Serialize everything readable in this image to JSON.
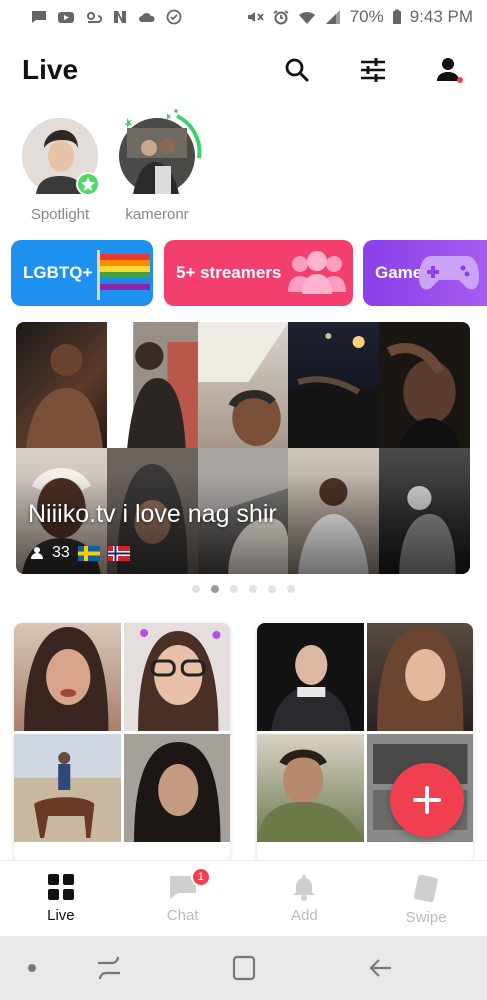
{
  "statusbar": {
    "battery": "70%",
    "time": "9:43 PM",
    "icons": [
      "message-icon",
      "youtube-icon",
      "weather-icon",
      "n-icon",
      "cloud-icon",
      "check-circle-icon",
      "mute-icon",
      "alarm-icon",
      "wifi-icon",
      "signal-icon",
      "battery-icon"
    ]
  },
  "header": {
    "title": "Live",
    "actions": [
      "search-icon",
      "filter-icon",
      "profile-icon"
    ],
    "profile_dot_color": "#f0404f"
  },
  "stories": [
    {
      "label": "Spotlight",
      "badge": "star-badge-icon"
    },
    {
      "label": "kameronr",
      "ring_color": "#3dd16b"
    }
  ],
  "categories": [
    {
      "label": "LGBTQ+",
      "color": "#1e90f0",
      "icon": "rainbow-flag-icon"
    },
    {
      "label": "5+ streamers",
      "color": "#f23f6d",
      "icon": "group-icon"
    },
    {
      "label": "Game",
      "color": "#8a3fe8",
      "icon": "gamepad-icon"
    }
  ],
  "featured": {
    "title": "Niiiko.tv i love nag shir",
    "viewers": "33",
    "flags": [
      "sweden-flag-icon",
      "norway-flag-icon"
    ],
    "page_count": 6,
    "active_page": 2
  },
  "cards": [
    {
      "name": "stream-card-1"
    },
    {
      "name": "stream-card-2"
    }
  ],
  "tabs": [
    {
      "label": "Live",
      "icon": "grid-icon",
      "active": true
    },
    {
      "label": "Chat",
      "icon": "chat-icon",
      "badge": "1"
    },
    {
      "label": "Add",
      "icon": "bell-icon"
    },
    {
      "label": "Swipe",
      "icon": "card-icon"
    }
  ],
  "colors": {
    "accent": "#f0404f",
    "text": "#111111",
    "muted": "#888888"
  }
}
